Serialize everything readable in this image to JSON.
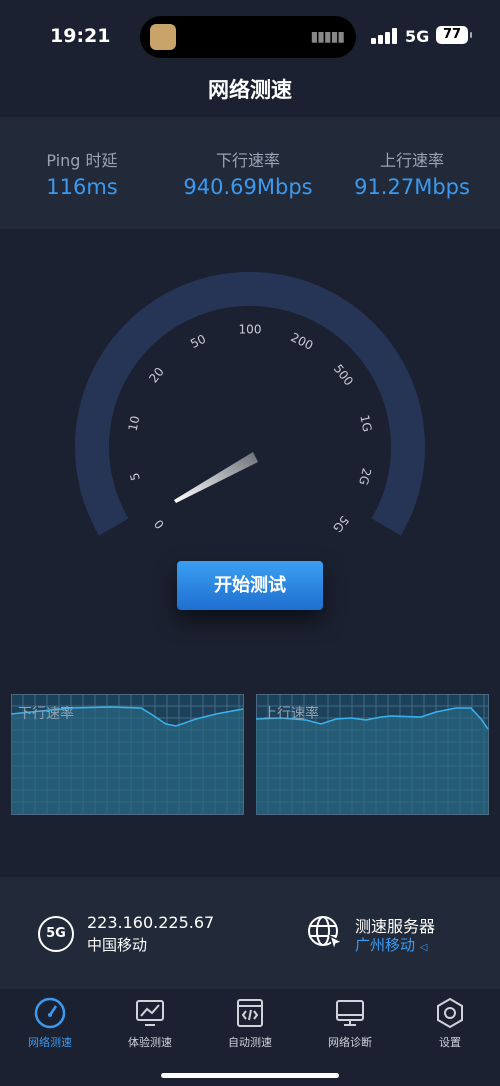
{
  "status": {
    "time": "19:21",
    "network": "5G",
    "battery": "77"
  },
  "title": "网络测速",
  "stats": [
    {
      "label": "Ping 时延",
      "value": "116ms"
    },
    {
      "label": "下行速率",
      "value": "940.69Mbps"
    },
    {
      "label": "上行速率",
      "value": "91.27Mbps"
    }
  ],
  "gauge": {
    "ticks": [
      "0",
      "5",
      "10",
      "20",
      "50",
      "100",
      "200",
      "500",
      "1G",
      "2G",
      "5G"
    ],
    "needle_value": "5"
  },
  "start_button": "开始测试",
  "graphs": {
    "download_label": "下行速率",
    "upload_label": "上行速率"
  },
  "info": {
    "ip": "223.160.225.67",
    "isp": "中国移动",
    "server_label": "测速服务器",
    "server_value": "广州移动"
  },
  "tabs": [
    {
      "label": "网络测速",
      "icon": "speedometer-icon",
      "active": true
    },
    {
      "label": "体验测速",
      "icon": "chart-monitor-icon",
      "active": false
    },
    {
      "label": "自动测速",
      "icon": "code-window-icon",
      "active": false
    },
    {
      "label": "网络诊断",
      "icon": "monitor-icon",
      "active": false
    },
    {
      "label": "设置",
      "icon": "settings-hexagon-icon",
      "active": false
    }
  ],
  "colors": {
    "accent": "#3b9af0",
    "background": "#1b2130",
    "panel": "#222a3a",
    "gauge_ring": "#263456"
  }
}
